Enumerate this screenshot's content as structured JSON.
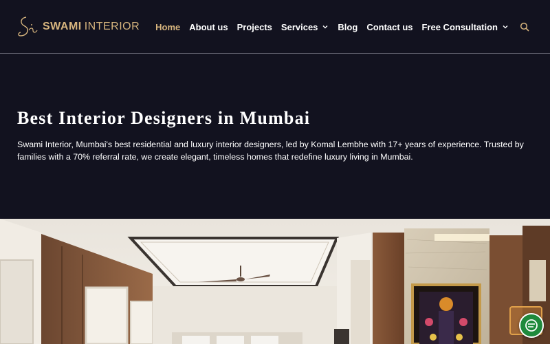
{
  "brand": {
    "name_bold": "SWAMI",
    "name_light": "INTERIOR",
    "logo_icon": "signature-logo-icon"
  },
  "nav": {
    "items": [
      {
        "label": "Home",
        "active": true,
        "dropdown": false
      },
      {
        "label": "About us",
        "active": false,
        "dropdown": false
      },
      {
        "label": "Projects",
        "active": false,
        "dropdown": false
      },
      {
        "label": "Services",
        "active": false,
        "dropdown": true
      },
      {
        "label": "Blog",
        "active": false,
        "dropdown": false
      },
      {
        "label": "Contact us",
        "active": false,
        "dropdown": false
      },
      {
        "label": "Free Consultation",
        "active": false,
        "dropdown": true
      }
    ],
    "search_icon": "search-icon"
  },
  "hero": {
    "title": "Best Interior Designers in Mumbai",
    "description": "Swami Interior, Mumbai's best residential and luxury interior designers, led by Komal Lembhe with 17+ years of experience. Trusted by families with a 70% referral rate, we create elegant, timeless homes that redefine luxury living in Mumbai."
  },
  "widgets": {
    "chat_icon": "chat-icon"
  },
  "colors": {
    "background": "#12121f",
    "accent_gold": "#d7b57e",
    "text": "#ffffff",
    "divider": "#6c6c78",
    "chat_green": "#1f8a3c"
  }
}
